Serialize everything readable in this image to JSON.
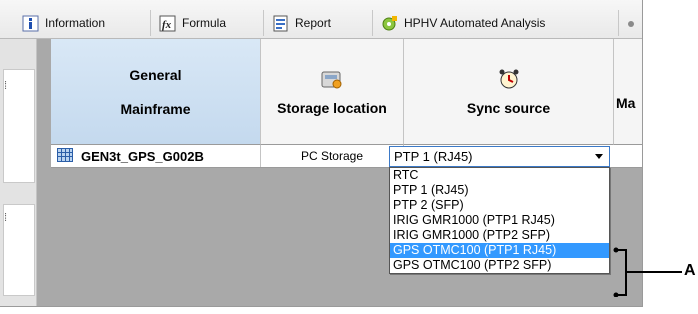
{
  "tabs": [
    {
      "label": "Information",
      "icon": "info-icon"
    },
    {
      "label": "Formula",
      "icon": "formula-icon"
    },
    {
      "label": "Report",
      "icon": "report-icon"
    },
    {
      "label": "HPHV Automated Analysis",
      "icon": "analysis-icon"
    }
  ],
  "columns": {
    "general_line1": "General",
    "general_line2": "Mainframe",
    "storage": "Storage location",
    "sync": "Sync source",
    "partial": "Ma"
  },
  "row": {
    "mainframe": "GEN3t_GPS_G002B",
    "storage": "PC Storage",
    "sync": "PTP 1 (RJ45)"
  },
  "sync_options": [
    "RTC",
    "PTP 1 (RJ45)",
    "PTP 2 (SFP)",
    "IRIG GMR1000 (PTP1 RJ45)",
    "IRIG GMR1000 (PTP2 SFP)",
    "GPS OTMC100 (PTP1 RJ45)",
    "GPS OTMC100 (PTP2 SFP)"
  ],
  "highlighted_option_index": 5,
  "callout_label": "A",
  "colors": {
    "highlight": "#3399ff",
    "header_selected": "#c4d9ee",
    "grid_bg": "#a9a9a9"
  }
}
